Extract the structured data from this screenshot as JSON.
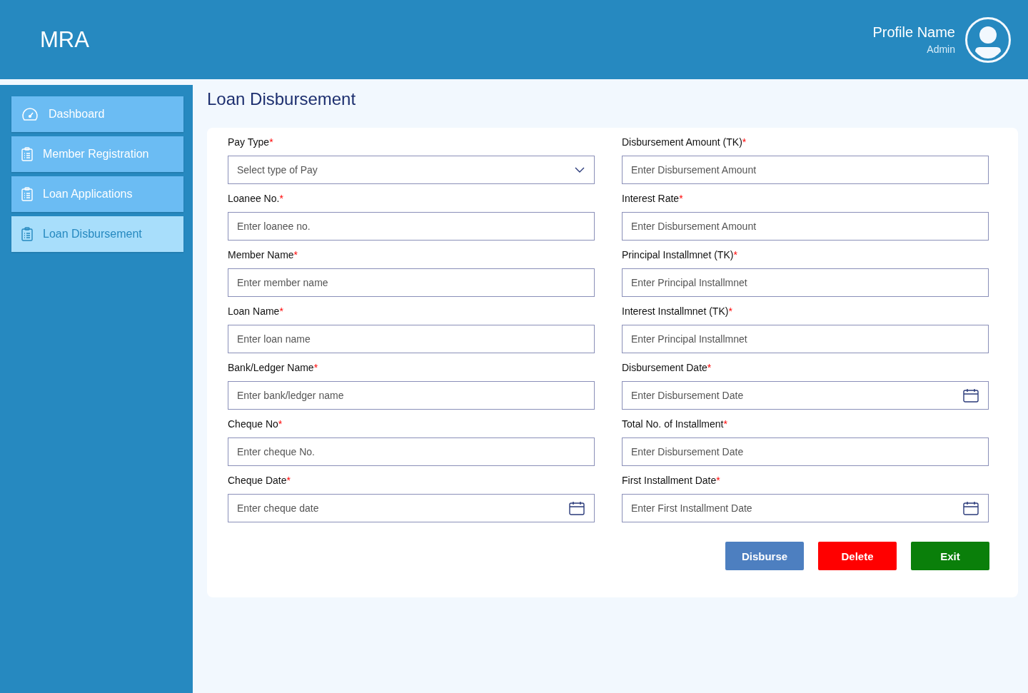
{
  "header": {
    "logo": "MRA",
    "profile": {
      "name": "Profile Name",
      "role": "Admin"
    }
  },
  "sidebar": {
    "items": [
      {
        "label": "Dashboard",
        "selected": false
      },
      {
        "label": "Member Registration",
        "selected": false
      },
      {
        "label": "Loan Applications",
        "selected": false
      },
      {
        "label": "Loan Disbursement",
        "selected": true
      }
    ]
  },
  "page_title": "Loan Disbursement",
  "form": {
    "left": [
      {
        "label": "Pay Type",
        "mark": "*",
        "kind": "select",
        "placeholder": "Select type of Pay"
      },
      {
        "label": "Loanee No.",
        "mark": "*",
        "kind": "text",
        "placeholder": "Enter loanee no."
      },
      {
        "label": "Member Name",
        "mark": "*",
        "kind": "text",
        "placeholder": "Enter member name"
      },
      {
        "label": "Loan Name",
        "mark": "*",
        "kind": "text",
        "placeholder": "Enter loan name"
      },
      {
        "label": "Bank/Ledger Name",
        "mark": "*",
        "kind": "text",
        "placeholder": "Enter bank/ledger name"
      },
      {
        "label": "Cheque No",
        "mark": "*",
        "kind": "text",
        "placeholder": "Enter cheque No."
      },
      {
        "label": "Cheque Date",
        "mark": "*",
        "kind": "date",
        "placeholder": "Enter cheque date"
      }
    ],
    "right": [
      {
        "label": "Disbursement Amount (TK)",
        "mark": "*",
        "kind": "text",
        "placeholder": "Enter Disbursement Amount"
      },
      {
        "label": "Interest Rate",
        "mark": "*",
        "kind": "text",
        "placeholder": "Enter Disbursement Amount"
      },
      {
        "label": "Principal Installmnet (TK)",
        "mark": "*",
        "kind": "text",
        "placeholder": "Enter Principal Installmnet"
      },
      {
        "label": "Interest Installmnet (TK)",
        "mark": "*",
        "kind": "text",
        "placeholder": "Enter Principal Installmnet"
      },
      {
        "label": "Disbursement Date",
        "mark": "*",
        "kind": "date",
        "placeholder": "Enter Disbursement Date"
      },
      {
        "label": "Total No. of Installment",
        "mark": "*",
        "kind": "text",
        "placeholder": "Enter Disbursement Date"
      },
      {
        "label": "First Installment Date",
        "mark": "*",
        "kind": "date",
        "placeholder": "Enter First Installment Date"
      }
    ]
  },
  "buttons": [
    {
      "label": "Disburse",
      "kind": "primary"
    },
    {
      "label": "Delete",
      "kind": "danger"
    },
    {
      "label": "Exit",
      "kind": "success"
    }
  ]
}
